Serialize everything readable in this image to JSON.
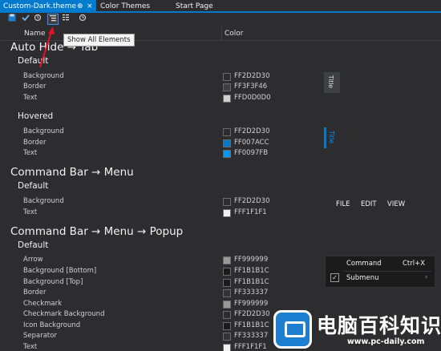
{
  "tabs": [
    {
      "label": "Custom-Dark.theme",
      "pin": "⊕",
      "close": "×",
      "active": true
    },
    {
      "label": "Color Themes",
      "active": false
    },
    {
      "label": "Start Page",
      "active": false
    }
  ],
  "toolbar": {
    "icons": [
      "save-icon",
      "checkmark-icon",
      "refresh-icon",
      "show-commonly-used-icon",
      "show-all-elements-icon",
      "history-icon"
    ]
  },
  "columns": {
    "name": "Name",
    "color": "Color"
  },
  "tooltip": "Show All Elements",
  "sections": [
    {
      "title": "Auto Hide → Tab",
      "groups": [
        {
          "title": "Default",
          "rows": [
            {
              "label": "Background",
              "hex": "FF2D2D30",
              "color": "#2d2d30"
            },
            {
              "label": "Border",
              "hex": "FF3F3F46",
              "color": "#3f3f46"
            },
            {
              "label": "Text",
              "hex": "FFD0D0D0",
              "color": "#d0d0d0"
            }
          ]
        },
        {
          "title": "Hovered",
          "rows": [
            {
              "label": "Background",
              "hex": "FF2D2D30",
              "color": "#2d2d30"
            },
            {
              "label": "Border",
              "hex": "FF007ACC",
              "color": "#007acc"
            },
            {
              "label": "Text",
              "hex": "FF0097FB",
              "color": "#0097fb"
            }
          ]
        }
      ]
    },
    {
      "title": "Command Bar → Menu",
      "groups": [
        {
          "title": "Default",
          "rows": [
            {
              "label": "Background",
              "hex": "FF2D2D30",
              "color": "#2d2d30"
            },
            {
              "label": "Text",
              "hex": "FFF1F1F1",
              "color": "#f1f1f1"
            }
          ]
        }
      ]
    },
    {
      "title": "Command Bar → Menu → Popup",
      "groups": [
        {
          "title": "Default",
          "rows": [
            {
              "label": "Arrow",
              "hex": "FF999999",
              "color": "#999999"
            },
            {
              "label": "Background [Bottom]",
              "hex": "FF1B1B1C",
              "color": "#1b1b1c"
            },
            {
              "label": "Background [Top]",
              "hex": "FF1B1B1C",
              "color": "#1b1b1c"
            },
            {
              "label": "Border",
              "hex": "FF333337",
              "color": "#333337"
            },
            {
              "label": "Checkmark",
              "hex": "FF999999",
              "color": "#999999"
            },
            {
              "label": "Checkmark Background",
              "hex": "FF2D2D30",
              "color": "#2d2d30"
            },
            {
              "label": "Icon Background",
              "hex": "FF1B1B1C",
              "color": "#1b1b1c"
            },
            {
              "label": "Separator",
              "hex": "FF333337",
              "color": "#333337"
            },
            {
              "label": "Text",
              "hex": "FFF1F1F1",
              "color": "#f1f1f1"
            }
          ]
        }
      ]
    }
  ],
  "previews": {
    "tab_label": "Title",
    "menu_items": [
      "FILE",
      "EDIT",
      "VIEW"
    ],
    "popup": {
      "command": "Command",
      "shortcut": "Ctrl+X",
      "submenu": "Submenu",
      "check": "✓",
      "arrow": "›"
    }
  },
  "watermark": {
    "title": "电脑百科知识",
    "url": "www.pc-daily.com"
  },
  "colors": {
    "accent": "#007acc",
    "background": "#2d2d30",
    "tooltip_arrow": "#e81123"
  }
}
